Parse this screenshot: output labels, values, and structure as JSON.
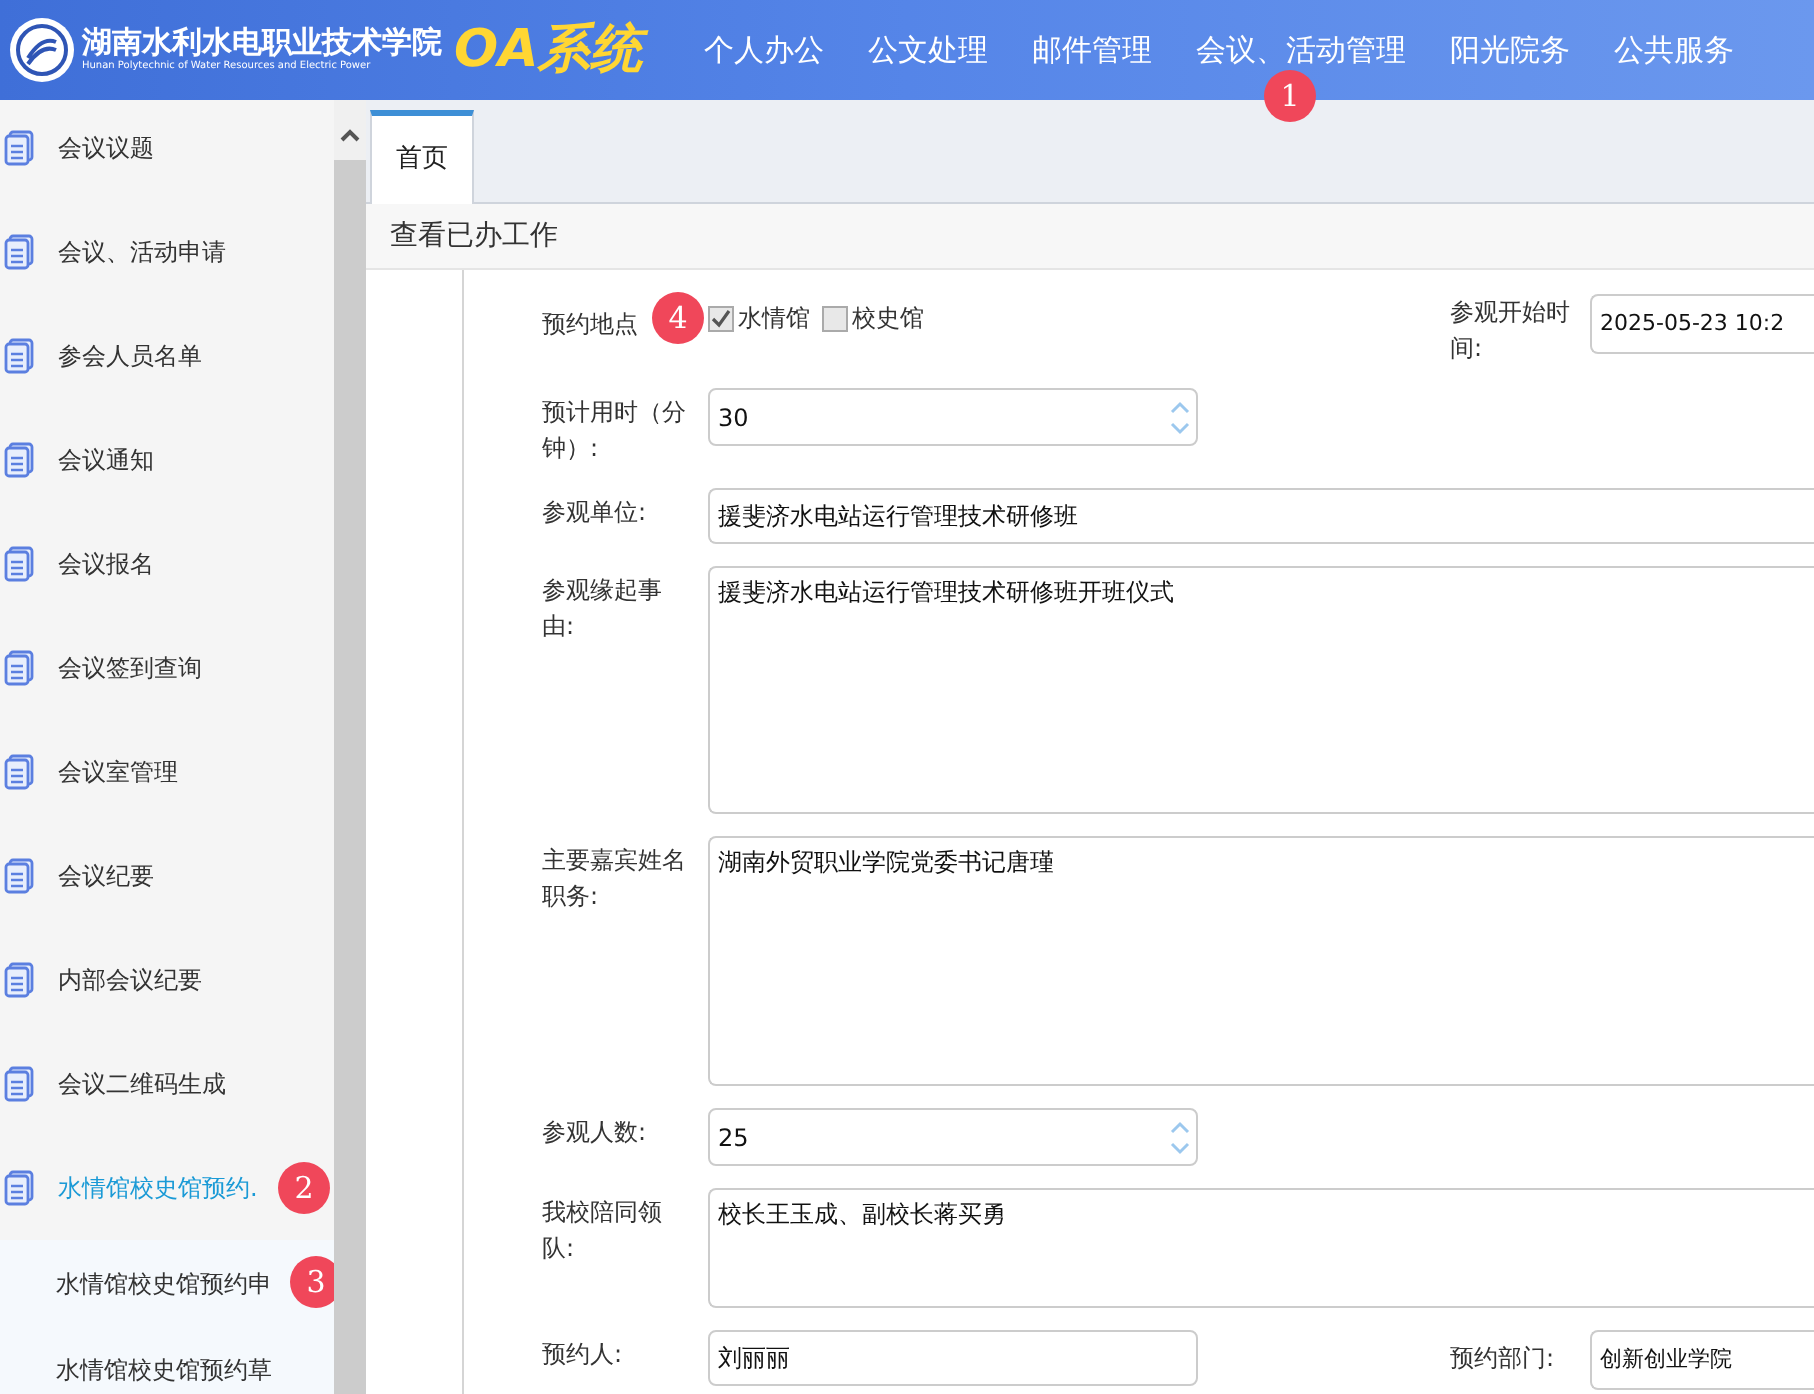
{
  "header": {
    "school_name": "湖南水利水电职业技术学院",
    "school_name_en": "Hunan Polytechnic of Water Resources and Electric Power",
    "system_name": "OA系统",
    "nav": [
      {
        "label": "个人办公"
      },
      {
        "label": "公文处理"
      },
      {
        "label": "邮件管理"
      },
      {
        "label": "会议、活动管理",
        "badge": "1"
      },
      {
        "label": "阳光院务"
      },
      {
        "label": "公共服务"
      }
    ]
  },
  "sidebar": {
    "items": [
      {
        "label": "会议议题",
        "selected": false
      },
      {
        "label": "会议、活动申请",
        "selected": false
      },
      {
        "label": "参会人员名单",
        "selected": false
      },
      {
        "label": "会议通知",
        "selected": false
      },
      {
        "label": "会议报名",
        "selected": false
      },
      {
        "label": "会议签到查询",
        "selected": false
      },
      {
        "label": "会议室管理",
        "selected": false
      },
      {
        "label": "会议纪要",
        "selected": false
      },
      {
        "label": "内部会议纪要",
        "selected": false
      },
      {
        "label": "会议二维码生成",
        "selected": false
      },
      {
        "label": "水情馆校史馆预约.",
        "selected": true,
        "badge": "2",
        "expanded": true,
        "children": [
          {
            "label": "水情馆校史馆预约申",
            "badge": "3"
          },
          {
            "label": "水情馆校史馆预约草"
          }
        ]
      }
    ]
  },
  "tabs": [
    {
      "label": "首页",
      "selected": true
    }
  ],
  "page_title": "查看已办工作",
  "form": [
    {
      "kind": "checkboxes",
      "label": "预约地点",
      "badge": "4",
      "options": [
        {
          "label": "水情馆",
          "checked": true
        },
        {
          "label": "校史馆",
          "checked": false
        }
      ],
      "right": {
        "label": "参观开始时间:",
        "value": "2025-05-23 10:2"
      }
    },
    {
      "kind": "spinner",
      "label": "预计用时（分钟）:",
      "value": "30"
    },
    {
      "kind": "text",
      "label": "参观单位:",
      "value": "援斐济水电站运行管理技术研修班"
    },
    {
      "kind": "textarea",
      "label": "参观缘起事由:",
      "value": "援斐济水电站运行管理技术研修班开班仪式"
    },
    {
      "kind": "textarea",
      "label": "主要嘉宾姓名职务:",
      "value": "湖南外贸职业学院党委书记唐瑾"
    },
    {
      "kind": "spinner",
      "label": "参观人数:",
      "value": "25"
    },
    {
      "kind": "textarea",
      "label": "我校陪同领队:",
      "value": "校长王玉成、副校长蒋买勇"
    },
    {
      "kind": "text",
      "label": "预约人:",
      "value": "刘丽丽",
      "right": {
        "label": "预约部门:",
        "value": "创新创业学院"
      }
    }
  ]
}
